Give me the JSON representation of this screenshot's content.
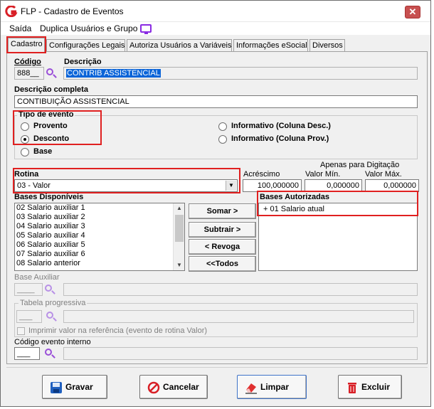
{
  "window": {
    "title": "FLP - Cadastro de Eventos",
    "close_glyph": "✕"
  },
  "menu": {
    "items": [
      "Saída",
      "Duplica Usuários e Grupo"
    ]
  },
  "tabs": [
    "Cadastro",
    "Configurações Legais",
    "Autoriza Usuários a Variáveis",
    "Informações eSocial",
    "Diversos"
  ],
  "form": {
    "codigo_label": "Código",
    "codigo_value": "888__",
    "descricao_label": "Descrição",
    "descricao_value": "CONTRIB ASSISTENCIAL",
    "descricao_completa_label": "Descrição completa",
    "descricao_completa_value": "CONTIBUIÇÃO ASSISTENCIAL",
    "tipo_evento": {
      "label": "Tipo de evento",
      "options": [
        "Provento",
        "Desconto",
        "Base",
        "Informativo (Coluna Desc.)",
        "Informativo (Coluna Prov.)"
      ],
      "selected": "Desconto"
    },
    "rotina_label": "Rotina",
    "rotina_value": "03 - Valor",
    "apenas_digitacao_label": "Apenas para Digitação",
    "acrescimo_label": "Acréscimo",
    "acrescimo_value": "100,000000",
    "valor_min_label": "Valor Mín.",
    "valor_min_value": "0,000000",
    "valor_max_label": "Valor Máx.",
    "valor_max_value": "0,000000",
    "bases_disponiveis_label": "Bases Disponíveis",
    "bases_disponiveis": [
      "02 Salario auxiliar 1",
      "03 Salario auxiliar 2",
      "04 Salario auxiliar 3",
      "05 Salario auxiliar 4",
      "06 Salario auxiliar 5",
      "07 Salario auxiliar 6",
      "08 Salario anterior"
    ],
    "bases_autorizadas_label": "Bases Autorizadas",
    "bases_autorizadas": [
      "+ 01 Salario atual"
    ],
    "buttons": {
      "somar": "Somar >",
      "subtrair": "Subtrair >",
      "revoga": "< Revoga",
      "todos": "<<Todos"
    },
    "base_auxiliar_label": "Base Auxiliar",
    "base_auxiliar_value": "____",
    "tabela_progressiva_label": "Tabela progressiva",
    "tabela_progressiva_value": "___",
    "imprimir_label": "Imprimir valor na referência (evento de rotina Valor)",
    "codigo_evento_interno_label": "Código evento interno",
    "codigo_evento_interno_value": "___"
  },
  "footer": {
    "gravar": "Gravar",
    "cancelar": "Cancelar",
    "limpar": "Limpar",
    "excluir": "Excluir"
  },
  "colors": {
    "highlight": "#e02020",
    "selection": "#0a64d8",
    "icon_purple": "#9a4fd8"
  }
}
